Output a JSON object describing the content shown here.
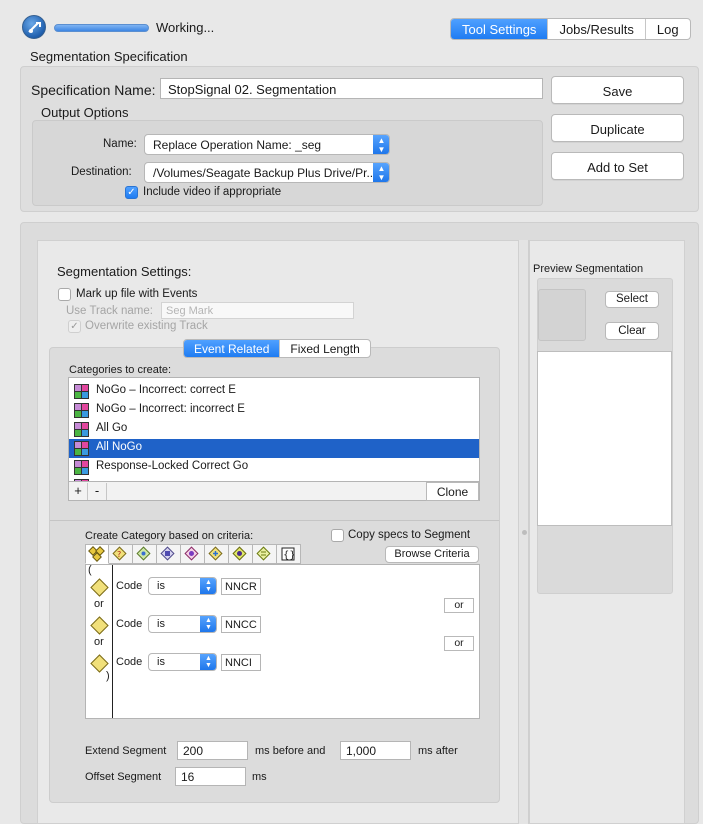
{
  "status": {
    "text": "Working...",
    "progress": 1.0
  },
  "tabs": [
    {
      "label": "Tool Settings",
      "active": true
    },
    {
      "label": "Jobs/Results",
      "active": false
    },
    {
      "label": "Log",
      "active": false
    }
  ],
  "spec": {
    "section_title": "Segmentation Specification",
    "name_label": "Specification Name:",
    "name_value": "StopSignal 02. Segmentation",
    "output": {
      "title": "Output Options",
      "name_label": "Name:",
      "name_value": "Replace Operation Name: _seg",
      "destination_label": "Destination:",
      "destination_value": "/Volumes/Seagate Backup Plus Drive/Pr...",
      "include_video_label": "Include video if appropriate",
      "include_video_checked": true
    },
    "buttons": {
      "save": "Save",
      "duplicate": "Duplicate",
      "add_to_set": "Add to Set"
    }
  },
  "segmentation": {
    "title": "Segmentation Settings:",
    "markup_label": "Mark up file with Events",
    "markup_checked": false,
    "track_name_label": "Use Track name:",
    "track_name_placeholder": "Seg Mark",
    "overwrite_label": "Overwrite existing Track",
    "overwrite_checked": true,
    "mode_tabs": [
      {
        "label": "Event Related",
        "active": true
      },
      {
        "label": "Fixed Length",
        "active": false
      }
    ],
    "categories_label": "Categories to create:",
    "categories": [
      {
        "label": "NoGo – Incorrect: correct E",
        "selected": false
      },
      {
        "label": "NoGo – Incorrect: incorrect E",
        "selected": false
      },
      {
        "label": "All Go",
        "selected": false
      },
      {
        "label": "All NoGo",
        "selected": true
      },
      {
        "label": "Response-Locked Correct Go",
        "selected": false
      }
    ],
    "add_symbol": "+",
    "remove_symbol": "-",
    "clone_label": "Clone",
    "criteria_title": "Create Category based on criteria:",
    "copy_specs_label": "Copy specs to Segment",
    "copy_specs_checked": false,
    "browse_label": "Browse Criteria",
    "open_paren": "(",
    "close_paren": ")",
    "criteria": [
      {
        "field": "Code",
        "operator": "is",
        "value": "NNCR"
      },
      {
        "field": "Code",
        "operator": "is",
        "value": "NNCC"
      },
      {
        "field": "Code",
        "operator": "is",
        "value": "NNCI"
      }
    ],
    "or_label": "or",
    "extend_label": "Extend Segment",
    "extend_before": "200",
    "before_label": "ms before and",
    "extend_after": "1,000",
    "after_label": "ms after",
    "offset_label": "Offset Segment",
    "offset_value": "16",
    "offset_unit": "ms"
  },
  "preview": {
    "title": "Preview Segmentation",
    "select_label": "Select",
    "clear_label": "Clear"
  },
  "colors": {
    "accent": "#1f7cf2",
    "selection": "#1f62c8",
    "criteria_icon": "#f1e07a"
  },
  "icons": [
    "app-logo-icon",
    "criteria-condition-icon",
    "chevron-updown-icon",
    "category-grid-icon",
    "check-icon"
  ]
}
